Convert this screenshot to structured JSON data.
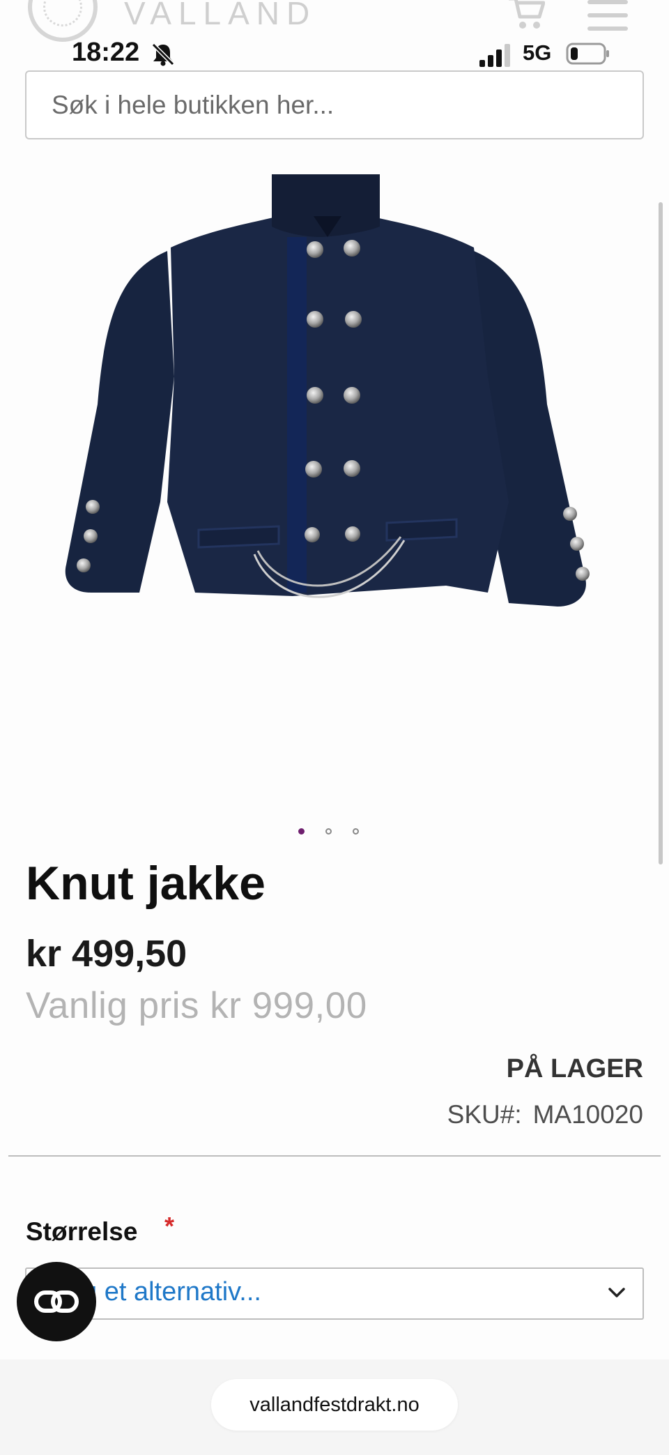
{
  "header": {
    "logo_text": "VALLAND",
    "cart_icon": "cart-icon",
    "menu_icon": "hamburger-menu-icon"
  },
  "status_bar": {
    "time": "18:22",
    "network": "5G",
    "icons": [
      "bell-slash-icon",
      "signal-icon",
      "battery-icon"
    ]
  },
  "search": {
    "placeholder": "Søk i hele butikken her..."
  },
  "gallery": {
    "image_count": 3,
    "active_index": 0,
    "active_color": "#6e1f6e"
  },
  "product": {
    "title": "Knut jakke",
    "price": "kr 499,50",
    "regular_price": "Vanlig pris kr 999,00",
    "stock_status": "PÅ LAGER",
    "sku_label": "SKU#:",
    "sku_value": "MA10020"
  },
  "options": {
    "size_label": "Størrelse",
    "required_mark": "*",
    "size_select_value": "g et alternativ..."
  },
  "browser": {
    "url": "vallandfestdrakt.no"
  }
}
